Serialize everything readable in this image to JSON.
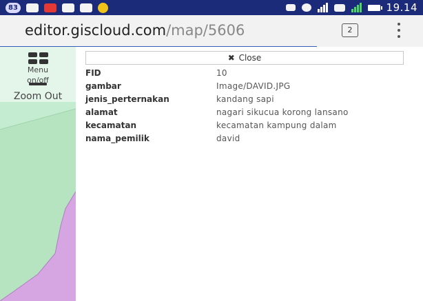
{
  "status_bar": {
    "notification_badge": "83",
    "time": "19.14"
  },
  "browser": {
    "url_host": "editor.giscloud.com",
    "url_path": "/map/5606",
    "tab_count": "2"
  },
  "map_controls": {
    "menu_label_line1": "Menu",
    "menu_label_line2": "on/off",
    "zoom_out_label": "Zoom Out"
  },
  "panel": {
    "close_label": "Close",
    "attributes": [
      {
        "key": "FID",
        "value": "10"
      },
      {
        "key": "gambar",
        "value": "Image/DAVID.JPG"
      },
      {
        "key": "jenis_perternakan",
        "value": "kandang sapi"
      },
      {
        "key": "alamat",
        "value": "nagari sikucua korong lansano"
      },
      {
        "key": "kecamatan",
        "value": "kecamatan kampung dalam"
      },
      {
        "key": "nama_pemilik",
        "value": "david"
      }
    ]
  },
  "colors": {
    "status_bar": "#1c2a7a",
    "map_green": "#b7e4c0",
    "map_purple": "#d6a6e3",
    "url_accent": "#2f5db8"
  },
  "icons": [
    "signal-icon",
    "battery-icon",
    "tabs-icon",
    "overflow-menu-icon",
    "menu-toggle-icon",
    "zoom-out-icon",
    "close-icon"
  ]
}
